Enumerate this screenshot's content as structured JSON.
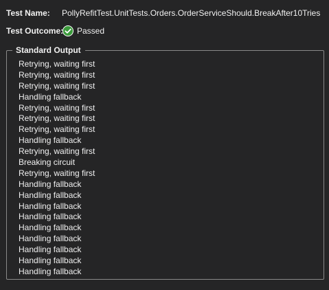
{
  "test": {
    "name_label": "Test Name:",
    "name_value": "PollyRefitTest.UnitTests.Orders.OrderServiceShould.BreakAfter10Tries",
    "outcome_label": "Test Outcome:",
    "outcome_value": "Passed",
    "outcome_icon": "check-circle-icon",
    "pass_color": "#3c9b3c"
  },
  "standard_output": {
    "title": "Standard Output",
    "lines": [
      "Retrying, waiting first",
      "Retrying, waiting first",
      "Retrying, waiting first",
      "Handling fallback",
      "Retrying, waiting first",
      "Retrying, waiting first",
      "Retrying, waiting first",
      "Handling fallback",
      "Retrying, waiting first",
      "Breaking circuit",
      "Retrying, waiting first",
      "Handling fallback",
      "Handling fallback",
      "Handling fallback",
      "Handling fallback",
      "Handling fallback",
      "Handling fallback",
      "Handling fallback",
      "Handling fallback",
      "Handling fallback"
    ]
  }
}
